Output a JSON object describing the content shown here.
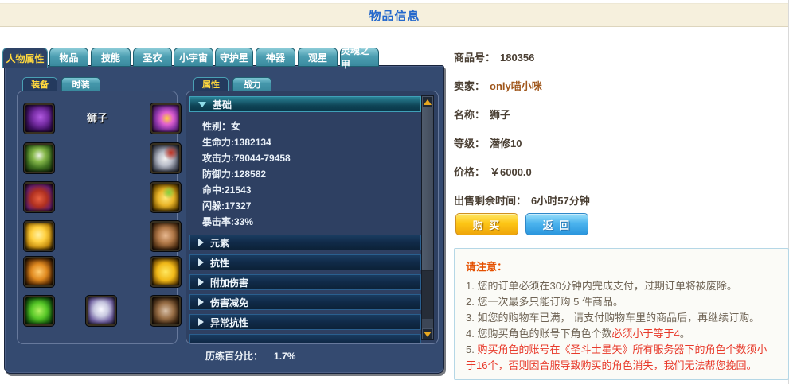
{
  "header": {
    "title": "物品信息"
  },
  "main_tabs": [
    {
      "label": "人物属性",
      "active": true
    },
    {
      "label": "物品"
    },
    {
      "label": "技能"
    },
    {
      "label": "圣衣"
    },
    {
      "label": "小宇宙"
    },
    {
      "label": "守护星"
    },
    {
      "label": "神器"
    },
    {
      "label": "观星"
    },
    {
      "label": "灵魂之甲"
    }
  ],
  "equipment": {
    "tabs": [
      {
        "label": "装备",
        "active": true
      },
      {
        "label": "时装"
      }
    ],
    "character_name": "狮子",
    "slot_icons": [
      "cape-icon",
      "chest-armor-icon",
      "pants-icon",
      "yellow-gem-icon",
      "claw-icon",
      "green-ribbon-icon",
      "orb-icon",
      "tome-icon",
      "gold-ring-icon",
      "bronze-ring-icon",
      "necklace-icon",
      "belt-icon",
      "cloak-icon"
    ]
  },
  "attributes": {
    "tabs": [
      {
        "label": "属性",
        "active": true
      },
      {
        "label": "战力"
      }
    ],
    "expanded_section": "基础",
    "stats": [
      "性别：女",
      "生命力:1382134",
      "攻击力:79044-79458",
      "防御力:128582",
      "命中:21543",
      "闪躲:17327",
      "暴击率:33%"
    ],
    "collapsed_sections": [
      "元素",
      "抗性",
      "附加伤害",
      "伤害减免",
      "异常抗性"
    ],
    "experience_label": "历练百分比：",
    "experience_value": "1.7%"
  },
  "product": {
    "fields": [
      {
        "label": "商品号：",
        "value": "180356"
      },
      {
        "label": "卖家：",
        "value": "only喵小咪"
      },
      {
        "label": "名称：",
        "value": "狮子"
      },
      {
        "label": "等级：",
        "value": "潜修10"
      },
      {
        "label": "价格：",
        "value": "￥6000.0"
      },
      {
        "label": "出售剩余时间：",
        "value": "6小时57分钟"
      }
    ],
    "buy_label": "购 买",
    "back_label": "返 回"
  },
  "notice": {
    "title": "请注意：",
    "items": [
      {
        "num": "1.",
        "text": "您的订单必须在30分钟内完成支付，过期订单将被废除。"
      },
      {
        "num": "2.",
        "text": "您一次最多只能订购 5 件商品。"
      },
      {
        "num": "3.",
        "text": "如您的购物车已满， 请支付购物车里的商品后，再继续订购。"
      },
      {
        "num": "4.",
        "text": "您购买角色的账号下角色个数",
        "highlight": "必须小于等于4",
        "suffix": "。"
      },
      {
        "num": "5.",
        "red_text": "购买角色的账号在《圣斗士星矢》所有服务器下的角色个数须小于16个，否则因合服导致购买的角色消失，我们无法帮您挽回。"
      }
    ]
  },
  "colors": {
    "title_blue": "#2468cc",
    "tab_teal": "#4d9fb2",
    "panel_navy": "#344a70",
    "active_tab_yellow": "#ffd83e",
    "buy_orange": "#fdc616",
    "back_blue": "#4cb4ee",
    "notice_red": "#e8392a",
    "label_brown": "#4a3f33",
    "seller_brown": "#a0571c"
  }
}
